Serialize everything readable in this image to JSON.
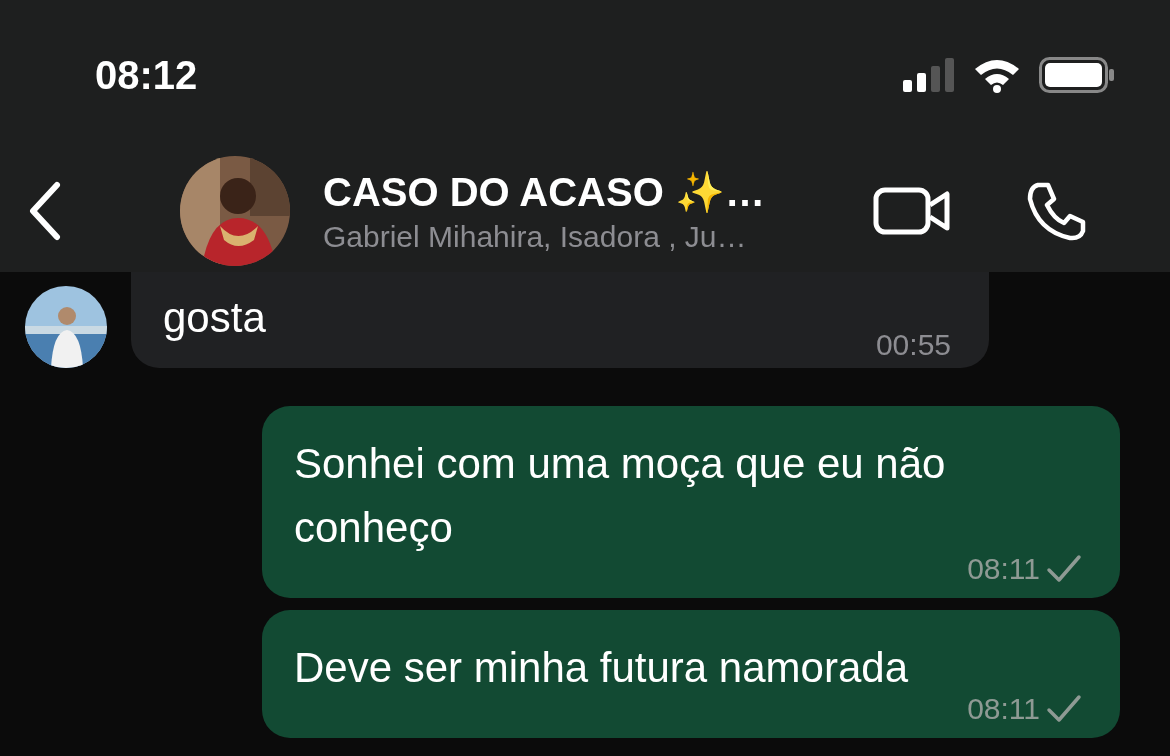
{
  "status_bar": {
    "time": "08:12"
  },
  "header": {
    "title": "CASO DO ACASO ✨…",
    "subtitle": "Gabriel Mihahira, Isadora , Ju…"
  },
  "messages": [
    {
      "kind": "incoming",
      "text": "gosta",
      "time": "00:55"
    },
    {
      "kind": "outgoing",
      "text": "Sonhei com uma moça que eu não conheço",
      "time": "08:11",
      "sent": true
    },
    {
      "kind": "outgoing",
      "text": "Deve ser minha futura namorada",
      "time": "08:11",
      "sent": true
    }
  ]
}
